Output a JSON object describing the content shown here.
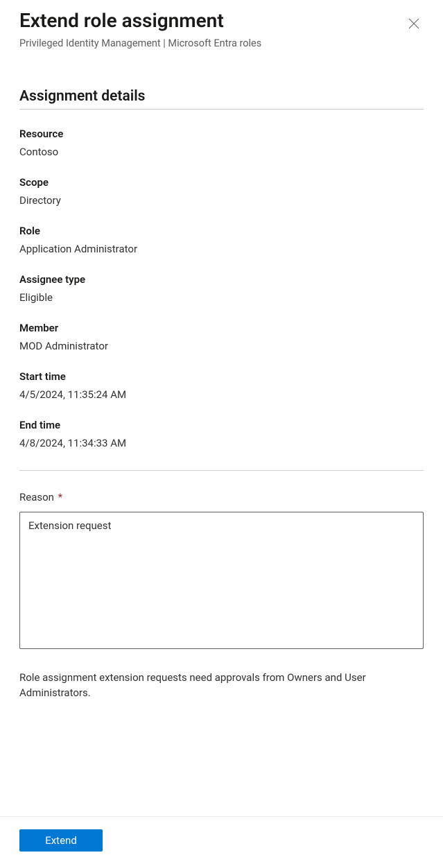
{
  "header": {
    "title": "Extend role assignment",
    "subtitle": "Privileged Identity Management | Microsoft Entra roles"
  },
  "section_heading": "Assignment details",
  "fields": {
    "resource": {
      "label": "Resource",
      "value": "Contoso"
    },
    "scope": {
      "label": "Scope",
      "value": "Directory"
    },
    "role": {
      "label": "Role",
      "value": "Application Administrator"
    },
    "assignee_type": {
      "label": "Assignee type",
      "value": "Eligible"
    },
    "member": {
      "label": "Member",
      "value": "MOD Administrator"
    },
    "start_time": {
      "label": "Start time",
      "value": "4/5/2024, 11:35:24 AM"
    },
    "end_time": {
      "label": "End time",
      "value": "4/8/2024, 11:34:33 AM"
    }
  },
  "reason": {
    "label": "Reason",
    "required_marker": "*",
    "value": "Extension request"
  },
  "info_text": "Role assignment extension requests need approvals from Owners and User Administrators.",
  "footer": {
    "extend_label": "Extend"
  }
}
